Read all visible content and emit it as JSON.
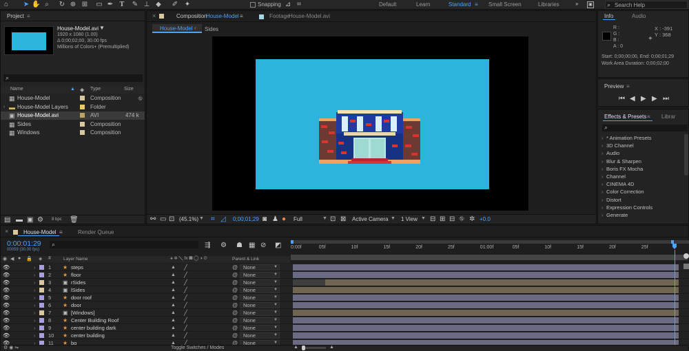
{
  "toolbar": {
    "snapping_label": "Snapping",
    "workspaces": [
      "Default",
      "Learn",
      "Standard",
      "Small Screen",
      "Libraries"
    ],
    "active_workspace": "Standard",
    "search_placeholder": "Search Help",
    "tools": [
      "home-icon",
      "selection-arrow-icon",
      "hand-icon",
      "zoom-icon",
      "rotate-icon",
      "camera-orbit-icon",
      "pan-behind-icon",
      "rectangle-icon",
      "pen-icon",
      "type-icon",
      "brush-icon",
      "clone-stamp-icon",
      "eraser-icon",
      "roto-brush-icon",
      "puppet-pin-icon"
    ]
  },
  "project": {
    "title": "Project",
    "selected_file": "House-Model.avi",
    "file_info": [
      "1920 x 1080 (1.00)",
      "Δ 0;00;02;00, 30.00 fps",
      "Millions of Colors+ (Premultiplied)"
    ],
    "col_name": "Name",
    "col_type": "Type",
    "col_size": "Size",
    "items": [
      {
        "name": "House-Model",
        "type": "Composition",
        "size": "",
        "color": "#d9c7a0",
        "kind": "comp"
      },
      {
        "name": "House-Model Layers",
        "type": "Folder",
        "size": "",
        "color": "#e6c96a",
        "kind": "folder"
      },
      {
        "name": "House-Model.avi",
        "type": "AVI",
        "size": "474 k",
        "color": "#b9a46a",
        "kind": "footage",
        "selected": true
      },
      {
        "name": "Sides",
        "type": "Composition",
        "size": "",
        "color": "#d9c7a0",
        "kind": "comp"
      },
      {
        "name": "Windows",
        "type": "Composition",
        "size": "",
        "color": "#d9c7a0",
        "kind": "comp"
      }
    ],
    "bpc_label": "8 bpc"
  },
  "composition": {
    "tab_prefix": "Composition",
    "tab_name": "House-Model",
    "footage_prefix": "Footage",
    "footage_name": "House-Model.avi",
    "breadcrumb_active": "House-Model",
    "breadcrumb_other": "Sides",
    "zoom": "(45.1%)",
    "timecode": "0;00;01;29",
    "resolution": "Full",
    "camera": "Active Camera",
    "view": "1 View",
    "exposure": "+0.0",
    "background_color": "#2bb5dc"
  },
  "info": {
    "tab_info": "Info",
    "tab_audio": "Audio",
    "rgba_labels": [
      "R :",
      "G :",
      "B :",
      "A : 0"
    ],
    "x_label": "X : -391",
    "y_label": "Y : 368",
    "start_end": "Start: 0;00;00;00, End: 0;00;01;29",
    "work_area": "Work Area Duration: 0;00;02;00"
  },
  "preview": {
    "title": "Preview"
  },
  "effects": {
    "tab_effects": "Effects & Presets",
    "tab_library": "Librar",
    "categories": [
      "* Animation Presets",
      "3D Channel",
      "Audio",
      "Blur & Sharpen",
      "Boris FX Mocha",
      "Channel",
      "CINEMA 4D",
      "Color Correction",
      "Distort",
      "Expression Controls",
      "Generate"
    ]
  },
  "timeline": {
    "tab_comp": "House-Model",
    "tab_render": "Render Queue",
    "current_time": "0:00:01:29",
    "fps_note": "00059 (30.00 fps)",
    "col_num": "#",
    "col_layer": "Layer Name",
    "col_parent": "Parent & Link",
    "ruler": [
      "0:00f",
      "05f",
      "10f",
      "15f",
      "20f",
      "25f",
      "01:00f",
      "05f",
      "10f",
      "15f",
      "20f",
      "25f"
    ],
    "layers": [
      {
        "num": "1",
        "name": "steps",
        "color": "#a99fe0",
        "parent": "None",
        "kind": "shape"
      },
      {
        "num": "2",
        "name": "floor",
        "color": "#a99fe0",
        "parent": "None",
        "kind": "shape"
      },
      {
        "num": "3",
        "name": "rSides",
        "color": "#d9c7a0",
        "parent": "None",
        "kind": "comp"
      },
      {
        "num": "4",
        "name": "lSides",
        "color": "#d9c7a0",
        "parent": "None",
        "kind": "comp"
      },
      {
        "num": "5",
        "name": "door roof",
        "color": "#a99fe0",
        "parent": "None",
        "kind": "shape"
      },
      {
        "num": "6",
        "name": "door",
        "color": "#a99fe0",
        "parent": "None",
        "kind": "shape"
      },
      {
        "num": "7",
        "name": "[Windows]",
        "color": "#d9c7a0",
        "parent": "None",
        "kind": "comp"
      },
      {
        "num": "8",
        "name": "Center Building Roof",
        "color": "#a99fe0",
        "parent": "None",
        "kind": "shape"
      },
      {
        "num": "9",
        "name": "center building dark",
        "color": "#a99fe0",
        "parent": "None",
        "kind": "shape"
      },
      {
        "num": "10",
        "name": "center building",
        "color": "#a99fe0",
        "parent": "None",
        "kind": "shape"
      },
      {
        "num": "11",
        "name": "bg",
        "color": "#a99fe0",
        "parent": "None",
        "kind": "shape"
      }
    ],
    "toggle_label": "Toggle Switches / Modes"
  }
}
